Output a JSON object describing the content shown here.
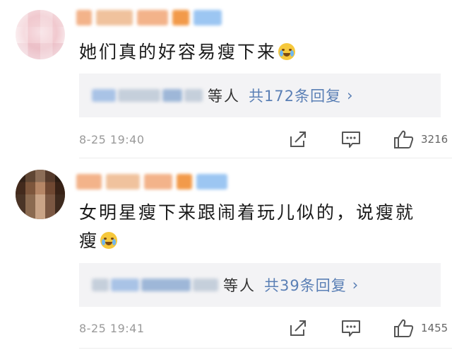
{
  "comments": [
    {
      "text": "她们真的好容易瘦下来",
      "replies": {
        "suffix": "等人",
        "total": "共172条回复",
        "chevron": "›"
      },
      "time": "8-25 19:40",
      "likes": "3216",
      "emoji": "crying-face"
    },
    {
      "text": "女明星瘦下来跟闹着玩儿似的，说瘦就瘦",
      "replies": {
        "suffix": "等人",
        "total": "共39条回复",
        "chevron": "›"
      },
      "time": "8-25 19:41",
      "likes": "1455",
      "emoji": "laughing-tears"
    }
  ],
  "colors": {
    "link_blue": "#5a7fb5",
    "meta_gray": "#9a9a9a",
    "reply_bg": "#f3f3f5"
  },
  "icons": [
    "share-icon",
    "comment-icon",
    "like-icon"
  ]
}
